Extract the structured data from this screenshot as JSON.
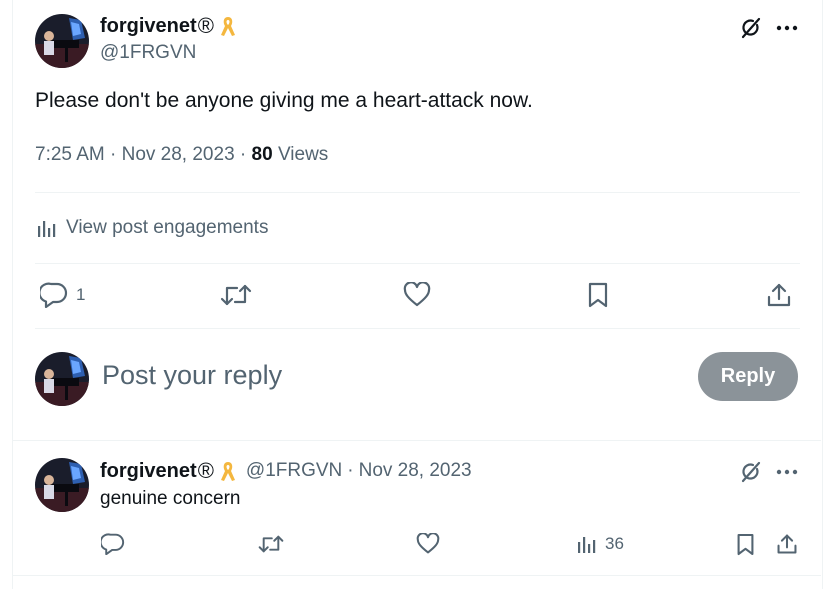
{
  "post": {
    "author_name": "forgivenet",
    "registered_mark": "®",
    "handle": "@1FRGVN",
    "text": "Please don't be anyone giving me a heart-attack now.",
    "time": "7:25 AM",
    "sep1": "·",
    "date": "Nov 28, 2023",
    "sep2": "·",
    "views_count": "80",
    "views_label": "Views",
    "engagements_label": "View post engagements",
    "reply_count": "1"
  },
  "composer": {
    "placeholder": "Post your reply",
    "reply_button": "Reply"
  },
  "reply": {
    "author_name": "forgivenet",
    "registered_mark": "®",
    "handle": "@1FRGVN",
    "sep": "·",
    "date": "Nov 28, 2023",
    "text": "genuine concern",
    "views_count": "36"
  },
  "icons": {
    "ribbon": "awareness-ribbon-icon",
    "grok": "grok-icon",
    "more": "more-icon",
    "analytics": "analytics-icon",
    "reply": "reply-icon",
    "repost": "repost-icon",
    "like": "like-icon",
    "bookmark": "bookmark-icon",
    "share": "share-icon"
  },
  "colors": {
    "text": "#0f1419",
    "muted": "#536471",
    "divider": "#eff3f4",
    "ribbon": "#f4b73f",
    "reply_button": "#8b9399"
  }
}
